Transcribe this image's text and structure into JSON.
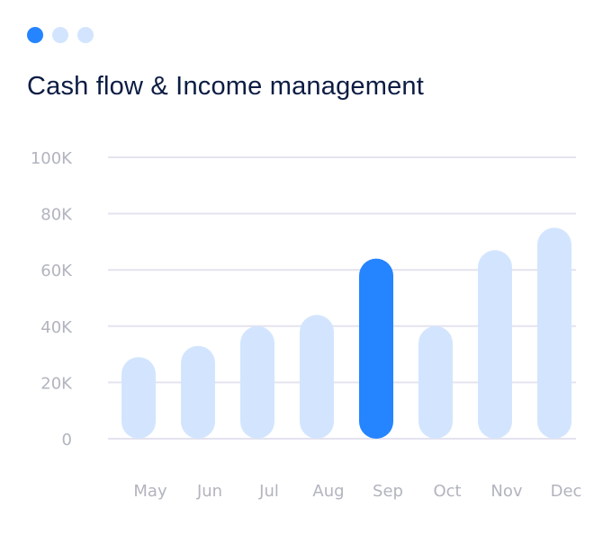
{
  "pagination": {
    "dots": [
      {
        "state": "active"
      },
      {
        "state": "inactive"
      },
      {
        "state": "inactive"
      }
    ]
  },
  "colors": {
    "highlight": "#2584ff",
    "bar": "#d3e5fe",
    "grid": "#e4e3ef",
    "title": "#0c1c43",
    "tick": "#b2b4be"
  },
  "chart_data": {
    "type": "bar",
    "title": "Cash flow & Income management",
    "xlabel": "",
    "ylabel": "",
    "categories": [
      "May",
      "Jun",
      "Jul",
      "Aug",
      "Sep",
      "Oct",
      "Nov",
      "Dec"
    ],
    "values": [
      29000,
      33000,
      40000,
      44000,
      64000,
      40000,
      67000,
      75000
    ],
    "highlighted": "Sep",
    "ylim": [
      0,
      100000
    ],
    "yticks": [
      0,
      20000,
      40000,
      60000,
      80000,
      100000
    ],
    "ytick_labels": [
      "0",
      "20K",
      "40K",
      "60K",
      "80K",
      "100K"
    ],
    "grid": true,
    "legend": "none"
  }
}
